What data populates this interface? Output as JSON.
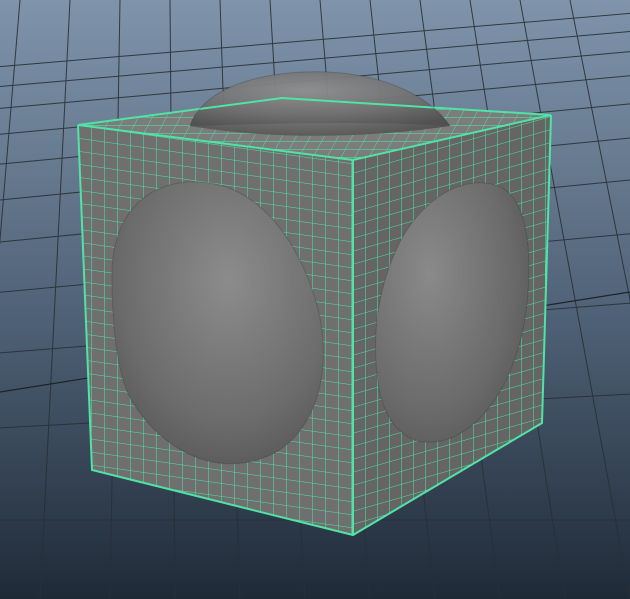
{
  "viewport": {
    "background_top": "#7f94ab",
    "background_bottom": "#1f2a37",
    "grid_color": "#2a2f35",
    "grid_axis_color": "#1a1d21"
  },
  "object": {
    "shape": "cube-with-sphere-boolean",
    "face_front_color": "#6f6f6f",
    "face_top_color": "#7c7c7c",
    "face_right_color": "#656565",
    "wireframe_color": "#4fe3a6",
    "sphere_color": "#6a6a6a",
    "sphere_highlight": "#9a9a9a",
    "selected": true
  }
}
